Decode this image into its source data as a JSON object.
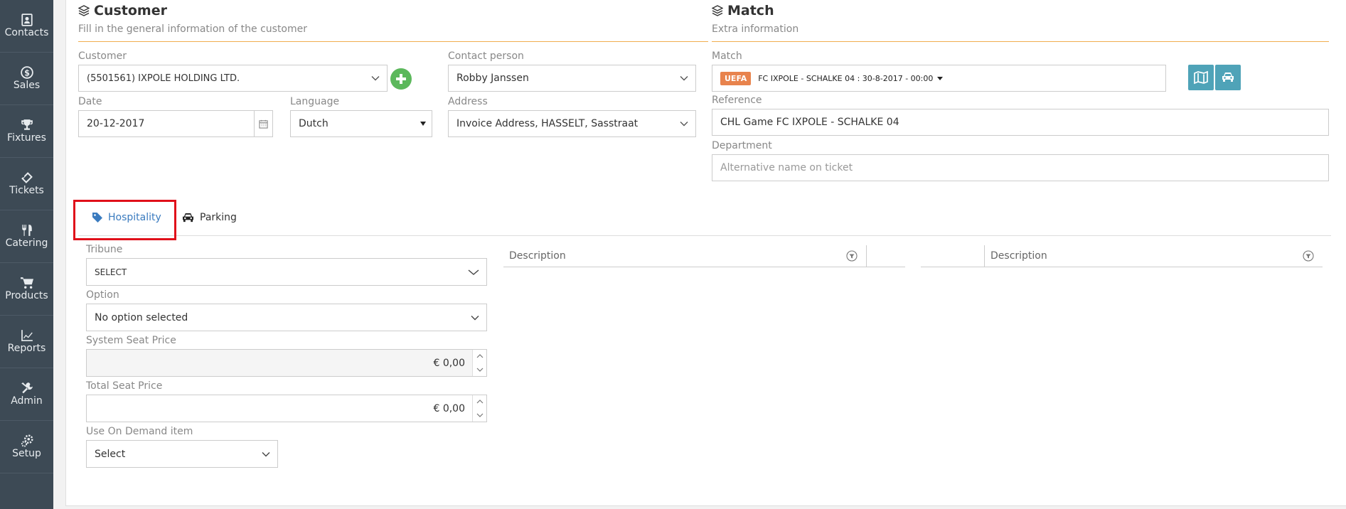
{
  "sidebar": {
    "items": [
      {
        "label": "Contacts",
        "icon": "contacts-icon"
      },
      {
        "label": "Sales",
        "icon": "dollar-icon"
      },
      {
        "label": "Fixtures",
        "icon": "trophy-icon"
      },
      {
        "label": "Tickets",
        "icon": "ticket-icon"
      },
      {
        "label": "Catering",
        "icon": "utensils-icon"
      },
      {
        "label": "Products",
        "icon": "cart-icon"
      },
      {
        "label": "Reports",
        "icon": "chart-icon"
      },
      {
        "label": "Admin",
        "icon": "tools-icon"
      },
      {
        "label": "Setup",
        "icon": "gears-icon"
      }
    ]
  },
  "customer_section": {
    "title": "Customer",
    "subtitle": "Fill in the general information of the customer",
    "customer_label": "Customer",
    "customer_value": "(5501561) IXPOLE HOLDING LTD.",
    "contact_label": "Contact person",
    "contact_value": "Robby Janssen",
    "date_label": "Date",
    "date_value": "20-12-2017",
    "language_label": "Language",
    "language_value": "Dutch",
    "address_label": "Address",
    "address_value": "Invoice Address, HASSELT, Sasstraat"
  },
  "match_section": {
    "title": "Match",
    "subtitle": "Extra information",
    "match_label": "Match",
    "match_badge": "UEFA",
    "match_value": "FC IXPOLE - SCHALKE 04 : 30-8-2017 - 00:00",
    "reference_label": "Reference",
    "reference_value": "CHL Game FC IXPOLE - SCHALKE 04",
    "department_label": "Department",
    "department_placeholder": "Alternative name on ticket"
  },
  "tabs": [
    {
      "label": "Hospitality",
      "active": true
    },
    {
      "label": "Parking",
      "active": false
    }
  ],
  "hospitality": {
    "tribune_label": "Tribune",
    "tribune_value": "SELECT",
    "option_label": "Option",
    "option_value": "No option selected",
    "system_seat_price_label": "System Seat Price",
    "system_seat_price_value": "€ 0,00",
    "total_seat_price_label": "Total Seat Price",
    "total_seat_price_value": "€ 0,00",
    "on_demand_label": "Use On Demand item",
    "on_demand_value": "Select"
  },
  "grids": {
    "left_header": "Description",
    "right_header": "Description"
  },
  "colors": {
    "sidebar_bg": "#3d4a55",
    "accent_orange": "#f0ad4e",
    "active_tab_blue": "#3a7bbf",
    "add_green": "#5cb85c",
    "icon_btn_teal": "#4fa3b8",
    "badge_orange": "#e8834d",
    "highlight_red": "#e0101a"
  }
}
